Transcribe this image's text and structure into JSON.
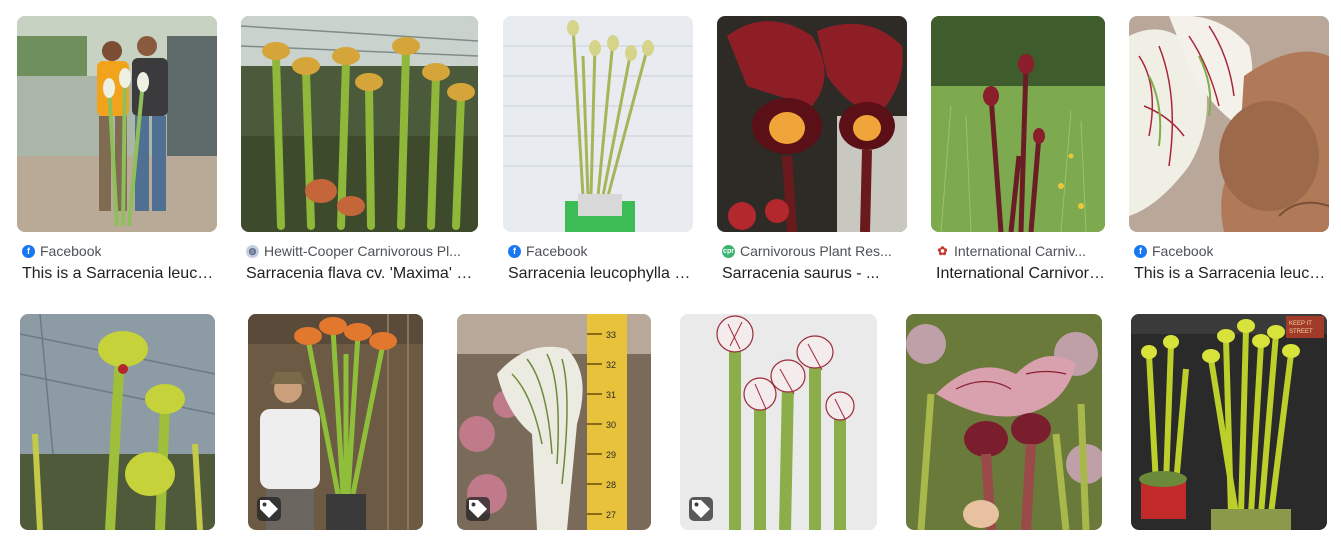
{
  "results_row1": [
    {
      "source": "Facebook",
      "source_icon": "facebook-icon",
      "title": "This is a Sarracenia leucophylla..."
    },
    {
      "source": "Hewitt-Cooper Carnivorous Pl...",
      "source_icon": "globe-icon",
      "title": "Sarracenia flava cv. 'Maxima' Red..."
    },
    {
      "source": "Facebook",
      "source_icon": "facebook-icon",
      "title": "Sarracenia leucophylla 'Tarnok' ..."
    },
    {
      "source": "Carnivorous Plant Res...",
      "source_icon": "cpr-icon",
      "title": "Sarracenia saurus - ..."
    },
    {
      "source": "International Carniv...",
      "source_icon": "icps-icon",
      "title": "International Carnivorous..."
    },
    {
      "source": "Facebook",
      "source_icon": "facebook-icon",
      "title": "This is a Sarracenia leucophylla..."
    }
  ],
  "results_row2": [
    {
      "label": "image-result-7",
      "has_tag": false
    },
    {
      "label": "image-result-8",
      "has_tag": true
    },
    {
      "label": "image-result-9",
      "has_tag": true
    },
    {
      "label": "image-result-10",
      "has_tag": true
    },
    {
      "label": "image-result-11",
      "has_tag": false
    },
    {
      "label": "image-result-12",
      "has_tag": false
    }
  ],
  "measuring_tape_numbers": [
    "33",
    "32",
    "31",
    "30",
    "29",
    "28",
    "27"
  ],
  "banner_text": "KEEP IT\nSTREET",
  "colors": {
    "facebook": "#1877f2",
    "text": "#202124",
    "source_text": "#4d5156"
  }
}
